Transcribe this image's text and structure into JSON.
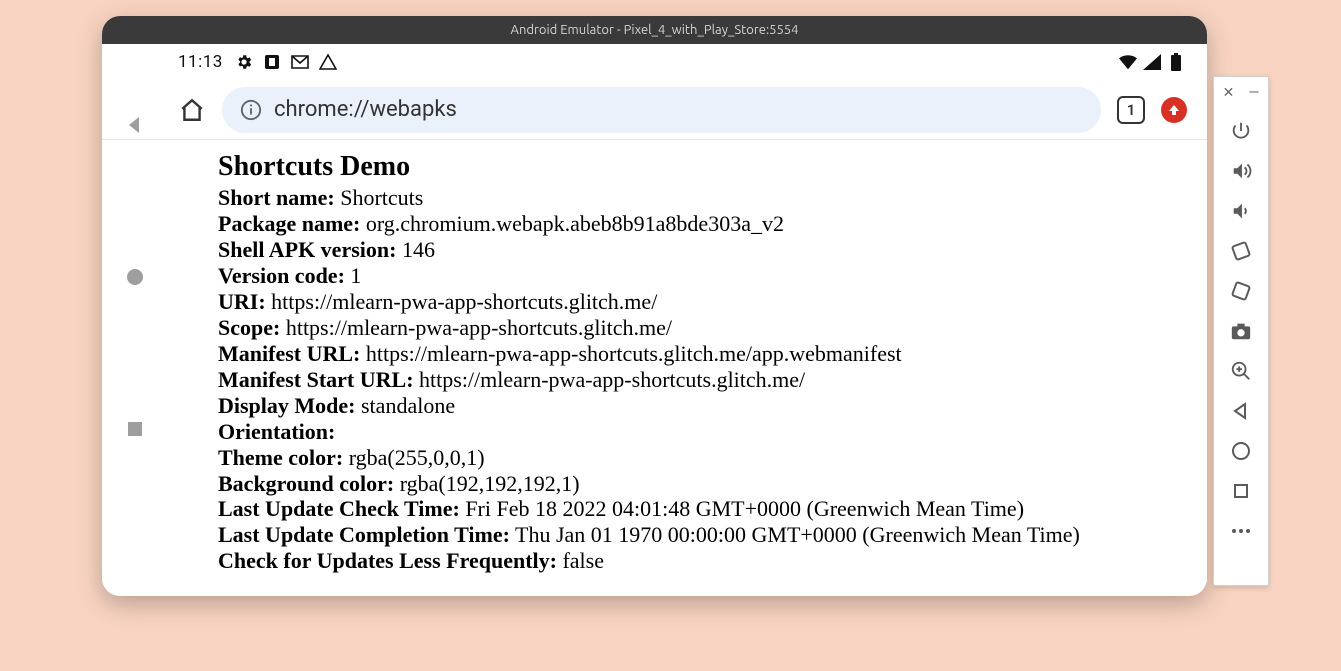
{
  "titlebar": "Android Emulator - Pixel_4_with_Play_Store:5554",
  "statusbar": {
    "time": "11:13"
  },
  "urlbar": {
    "url": "chrome://webapks",
    "tab_count": "1"
  },
  "page": {
    "title": "Shortcuts Demo",
    "fields": [
      {
        "label": "Short name:",
        "value": "Shortcuts"
      },
      {
        "label": "Package name:",
        "value": "org.chromium.webapk.abeb8b91a8bde303a_v2"
      },
      {
        "label": "Shell APK version:",
        "value": "146"
      },
      {
        "label": "Version code:",
        "value": "1"
      },
      {
        "label": "URI:",
        "value": "https://mlearn-pwa-app-shortcuts.glitch.me/"
      },
      {
        "label": "Scope:",
        "value": "https://mlearn-pwa-app-shortcuts.glitch.me/"
      },
      {
        "label": "Manifest URL:",
        "value": "https://mlearn-pwa-app-shortcuts.glitch.me/app.webmanifest"
      },
      {
        "label": "Manifest Start URL:",
        "value": "https://mlearn-pwa-app-shortcuts.glitch.me/"
      },
      {
        "label": "Display Mode:",
        "value": "standalone"
      },
      {
        "label": "Orientation:",
        "value": ""
      },
      {
        "label": "Theme color:",
        "value": "rgba(255,0,0,1)"
      },
      {
        "label": "Background color:",
        "value": "rgba(192,192,192,1)"
      },
      {
        "label": "Last Update Check Time:",
        "value": "Fri Feb 18 2022 04:01:48 GMT+0000 (Greenwich Mean Time)"
      },
      {
        "label": "Last Update Completion Time:",
        "value": "Thu Jan 01 1970 00:00:00 GMT+0000 (Greenwich Mean Time)"
      },
      {
        "label": "Check for Updates Less Frequently:",
        "value": "false"
      }
    ]
  }
}
